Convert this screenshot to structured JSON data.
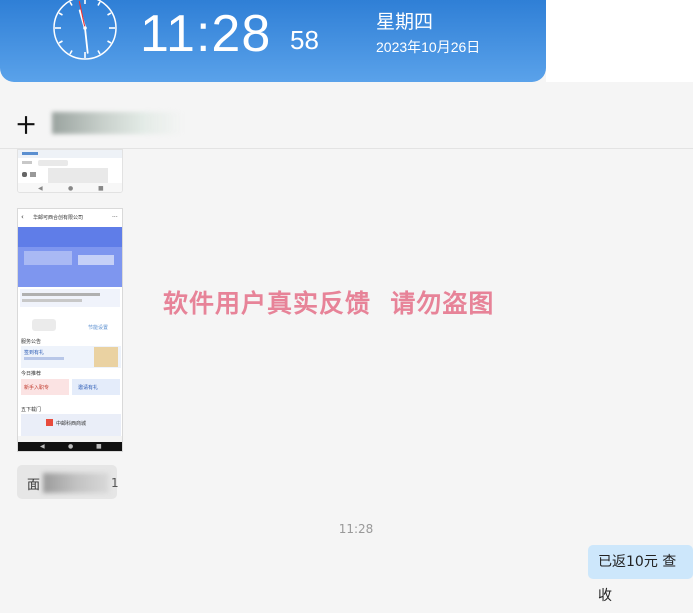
{
  "clock": {
    "time": "11:28",
    "seconds": "58",
    "weekday": "星期四",
    "date": "2023年10月26日",
    "analog": {
      "hour": 11,
      "minute": 28,
      "second": 58
    }
  },
  "chat": {
    "title_prefix": "十",
    "messages": {
      "timestamp": "11:28",
      "left_bubble_start": "面",
      "left_bubble_end": "1",
      "right_bubble": "已返10元 查收"
    }
  },
  "screenshot": {
    "company": "华邮可西合创有限公司",
    "section_service": "服务公告",
    "section_today": "今日推荐",
    "section_more": "五下载门",
    "item_sign": "签到有礼",
    "item_pink": "新手入职专",
    "item_blue": "邀请有礼",
    "item_help": "节能设置",
    "banner": "中邮科西商城"
  },
  "watermark": {
    "text": "软件用户真实反馈  请勿盗图"
  },
  "colors": {
    "accent": "#2f7fd6",
    "bubble_right": "#cde7fb",
    "watermark": "#e25c78"
  }
}
